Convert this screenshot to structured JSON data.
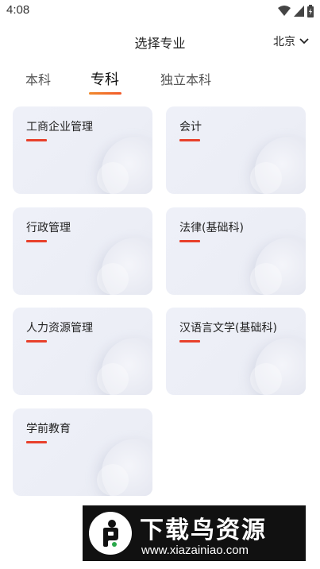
{
  "status": {
    "time": "4:08"
  },
  "header": {
    "title": "选择专业",
    "city": "北京"
  },
  "tabs": [
    {
      "label": "本科"
    },
    {
      "label": "专科"
    },
    {
      "label": "独立本科"
    }
  ],
  "majors": [
    {
      "label": "工商企业管理"
    },
    {
      "label": "会计"
    },
    {
      "label": "行政管理"
    },
    {
      "label": "法律(基础科)"
    },
    {
      "label": "人力资源管理"
    },
    {
      "label": "汉语言文学(基础科)"
    },
    {
      "label": "学前教育"
    }
  ],
  "watermark": {
    "title": "下载鸟资源",
    "url": "www.xiazainiao.com"
  },
  "colors": {
    "accent": "#e8402b",
    "tab_underline": "#f2702a"
  }
}
